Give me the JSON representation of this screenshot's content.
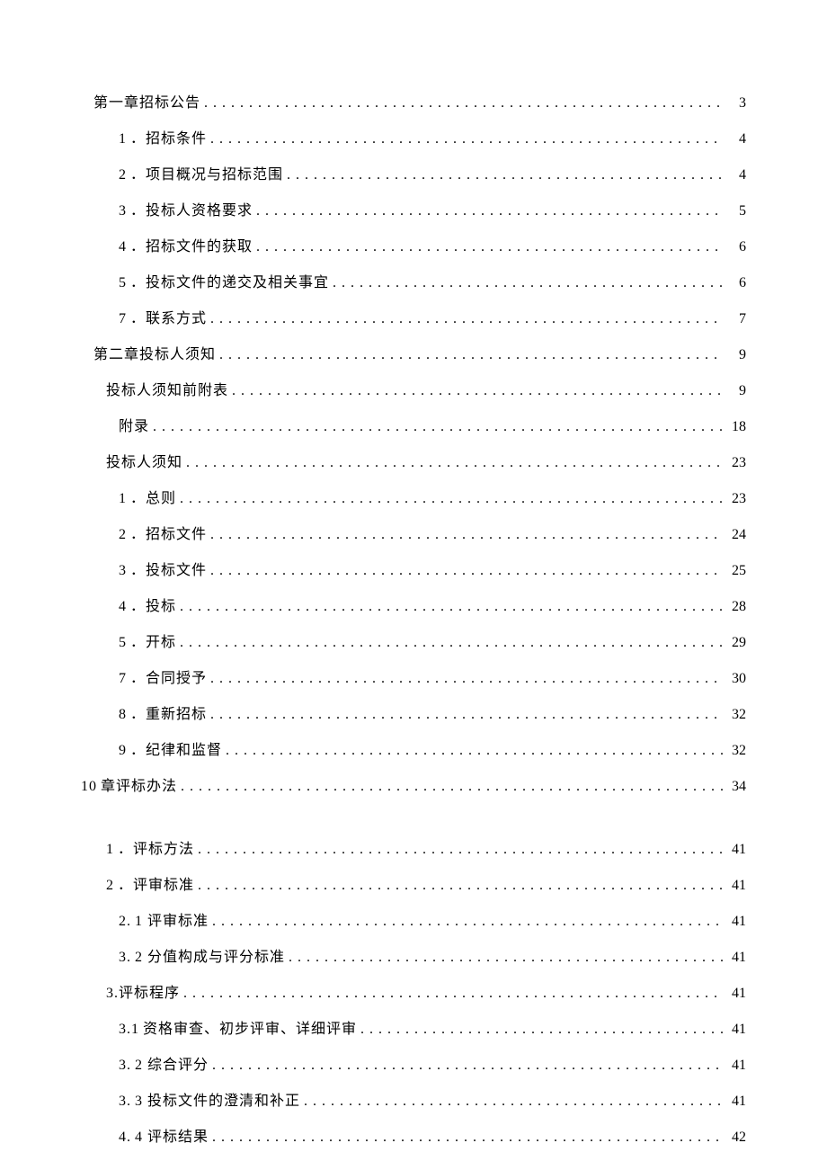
{
  "toc": [
    {
      "indent": "toc-indent-0",
      "num": "",
      "label": "第一章招标公告",
      "page": "3"
    },
    {
      "indent": "toc-indent-2",
      "num": "1",
      "label": "．招标条件",
      "page": "4"
    },
    {
      "indent": "toc-indent-2",
      "num": "2",
      "label": "．项目概况与招标范围",
      "page": "4"
    },
    {
      "indent": "toc-indent-2",
      "num": "3",
      "label": "．投标人资格要求",
      "page": "5"
    },
    {
      "indent": "toc-indent-2",
      "num": "4",
      "label": "．招标文件的获取",
      "page": "6"
    },
    {
      "indent": "toc-indent-2",
      "num": "5",
      "label": "．投标文件的递交及相关事宜",
      "page": "6"
    },
    {
      "indent": "toc-indent-2",
      "num": "7",
      "label": "．联系方式",
      "page": "7"
    },
    {
      "indent": "toc-indent-0",
      "num": "",
      "label": "第二章投标人须知",
      "page": "9"
    },
    {
      "indent": "toc-indent-1",
      "num": "",
      "label": "投标人须知前附表",
      "page": "9"
    },
    {
      "indent": "toc-indent-2",
      "num": "",
      "label": "附录",
      "page": "18"
    },
    {
      "indent": "toc-indent-1",
      "num": "",
      "label": "投标人须知",
      "page": "23"
    },
    {
      "indent": "toc-indent-2",
      "num": "1",
      "label": "．总则",
      "page": "23"
    },
    {
      "indent": "toc-indent-2",
      "num": "2",
      "label": "．招标文件",
      "page": "24"
    },
    {
      "indent": "toc-indent-2",
      "num": "3",
      "label": "．投标文件",
      "page": "25"
    },
    {
      "indent": "toc-indent-2",
      "num": "4",
      "label": "．投标",
      "page": "28"
    },
    {
      "indent": "toc-indent-2",
      "num": "5",
      "label": "．开标",
      "page": "29"
    },
    {
      "indent": "toc-indent-2",
      "num": "7",
      "label": "．合同授予",
      "page": "30"
    },
    {
      "indent": "toc-indent-2",
      "num": "8",
      "label": "．重新招标",
      "page": "32"
    },
    {
      "indent": "toc-indent-2",
      "num": "9",
      "label": "．纪律和监督",
      "page": "32"
    },
    {
      "indent": "toc-indent-neg",
      "num": "10",
      "label": "    章评标办法",
      "page": "34"
    },
    {
      "gap": true
    },
    {
      "indent": "toc-indent-1b",
      "num": "1",
      "label": "．评标方法",
      "page": "41"
    },
    {
      "indent": "toc-indent-1b",
      "num": "2",
      "label": "．评审标准",
      "page": "41"
    },
    {
      "indent": "toc-indent-2",
      "num": "2.",
      "label": " 1 评审标准",
      "page": "41"
    },
    {
      "indent": "toc-indent-2",
      "num": "3.",
      "label": " 2 分值构成与评分标准",
      "page": "41"
    },
    {
      "indent": "toc-indent-1b",
      "num": "",
      "label": "3.评标程序",
      "page": "41"
    },
    {
      "indent": "toc-indent-2",
      "num": "3.1",
      "label": "   资格审查、初步评审、详细评审",
      "page": "41"
    },
    {
      "indent": "toc-indent-2",
      "num": "3.",
      "label": " 2 综合评分",
      "page": "41"
    },
    {
      "indent": "toc-indent-2",
      "num": "3.",
      "label": " 3 投标文件的澄清和补正",
      "page": "41"
    },
    {
      "indent": "toc-indent-2",
      "num": "4.",
      "label": " 4 评标结果",
      "page": "42"
    }
  ]
}
